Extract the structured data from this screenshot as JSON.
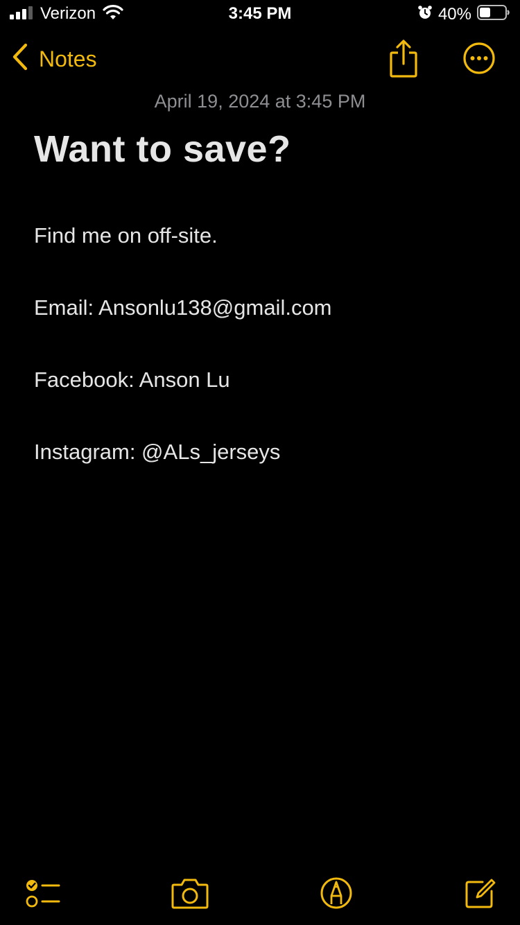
{
  "status_bar": {
    "carrier": "Verizon",
    "time": "3:45 PM",
    "battery_percent": "40%",
    "icons": [
      "signal-icon",
      "wifi-icon",
      "alarm-icon",
      "battery-icon"
    ]
  },
  "nav": {
    "back_label": "Notes",
    "back_icon": "chevron-left-icon",
    "share_icon": "share-icon",
    "more_icon": "more-icon"
  },
  "note": {
    "date": "April 19, 2024 at 3:45 PM",
    "title": "Want to save?",
    "lines": [
      "Find me on off-site.",
      "Email: Ansonlu138@gmail.com",
      "Facebook: Anson Lu",
      "Instagram: @ALs_jerseys"
    ]
  },
  "toolbar": {
    "icons": [
      "checklist-icon",
      "camera-icon",
      "markup-icon",
      "compose-icon"
    ]
  },
  "colors": {
    "accent": "#f2b90f",
    "background": "#000000",
    "text": "#e6e6e6",
    "secondary_text": "#8e8e93"
  }
}
